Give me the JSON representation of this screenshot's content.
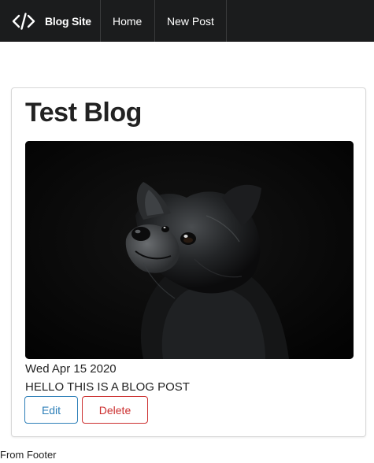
{
  "navbar": {
    "brand_label": "Blog Site",
    "brand_icon": "code-icon",
    "links": [
      {
        "label": "Home"
      },
      {
        "label": "New Post"
      }
    ],
    "background_color": "#1b1c1d"
  },
  "post": {
    "title": "Test Blog",
    "image_subject": "black dog",
    "date": "Wed Apr 15 2020",
    "body": "HELLO THIS IS A BLOG POST",
    "edit_label": "Edit",
    "delete_label": "Delete",
    "edit_color": "#2d7fb8",
    "delete_color": "#cc2f2f"
  },
  "footer": {
    "text": "From Footer"
  }
}
